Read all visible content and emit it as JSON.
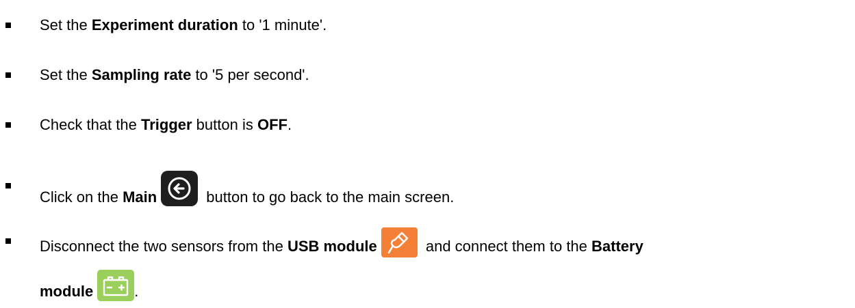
{
  "steps": [
    {
      "prefix": "Set the ",
      "bold": "Experiment duration",
      "suffix": " to '1 minute'."
    },
    {
      "prefix": "Set the ",
      "bold": "Sampling rate",
      "suffix": " to '5 per second'."
    },
    {
      "prefix": "Check that the ",
      "bold": "Trigger",
      "middle": " button is ",
      "bold2": "OFF",
      "suffix": "."
    },
    {
      "prefix": "Click on the ",
      "bold": "Main",
      "icon": "back-arrow-circle-icon",
      "suffix": " button to go back to the main screen."
    },
    {
      "prefix": "Disconnect the two sensors from the ",
      "bold": "USB module",
      "icon": "usb-plug-icon",
      "middle": " and connect them to the ",
      "bold2": "Battery",
      "line2_bold": "module",
      "icon2": "battery-icon",
      "suffix": "."
    }
  ],
  "colors": {
    "main_button_bg": "#1e1e1e",
    "usb_module_bg": "#f47f36",
    "battery_module_bg": "#9bcf5c"
  }
}
